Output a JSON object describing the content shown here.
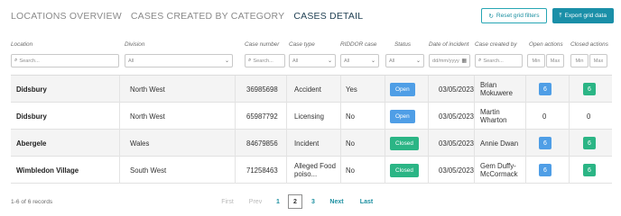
{
  "tabs": [
    {
      "label": "LOCATIONS OVERVIEW"
    },
    {
      "label": "CASES CREATED BY CATEGORY"
    },
    {
      "label": "CASES DETAIL"
    }
  ],
  "actions": {
    "reset_label": "Reset grid filters",
    "export_label": "Export grid data"
  },
  "columns": {
    "location": "Location",
    "division": "Division",
    "case_number": "Case number",
    "case_type": "Case type",
    "riddor": "RIDDOR case",
    "status": "Status",
    "date": "Date of incident",
    "created_by": "Case created by",
    "open_actions": "Open actions",
    "closed_actions": "Closed actions"
  },
  "filters": {
    "search_placeholder": "Search...",
    "all_label": "All",
    "date_placeholder": "dd/mm/yyyy",
    "min_label": "Min",
    "max_label": "Max"
  },
  "rows": [
    {
      "location": "Didsbury",
      "division": "North West",
      "case_number": "36985698",
      "case_type": "Accident",
      "riddor": "Yes",
      "status": "Open",
      "date": "03/05/2023",
      "created_by": "Brian Mokuwere",
      "open_actions": "6",
      "closed_actions": "6"
    },
    {
      "location": "Didsbury",
      "division": "North West",
      "case_number": "65987792",
      "case_type": "Licensing",
      "riddor": "No",
      "status": "Open",
      "date": "03/05/2023",
      "created_by": "Martin Wharton",
      "open_actions": "0",
      "closed_actions": "0"
    },
    {
      "location": "Abergele",
      "division": "Wales",
      "case_number": "84679856",
      "case_type": "Incident",
      "riddor": "No",
      "status": "Closed",
      "date": "03/05/2023",
      "created_by": "Annie Dwan",
      "open_actions": "6",
      "closed_actions": "6"
    },
    {
      "location": "Wimbledon Village",
      "division": "South West",
      "case_number": "71258463",
      "case_type": "Alleged Food poiso...",
      "riddor": "No",
      "status": "Closed",
      "date": "03/05/2023",
      "created_by": "Gem Duffy-McCormack",
      "open_actions": "6",
      "closed_actions": "6"
    }
  ],
  "footer": {
    "records": "1-6 of 6 records"
  },
  "pagination": {
    "first": "First",
    "prev": "Prev",
    "pages": [
      "1",
      "2",
      "3"
    ],
    "current": "2",
    "next": "Next",
    "last": "Last"
  },
  "colors": {
    "accent": "#1a8fa8",
    "open": "#4f9ee6",
    "closed": "#2bb585"
  },
  "icons": {
    "reset": "refresh-icon",
    "export": "upload-icon",
    "search": "search-icon",
    "dropdown": "chevron-down-icon",
    "date": "calendar-icon"
  }
}
